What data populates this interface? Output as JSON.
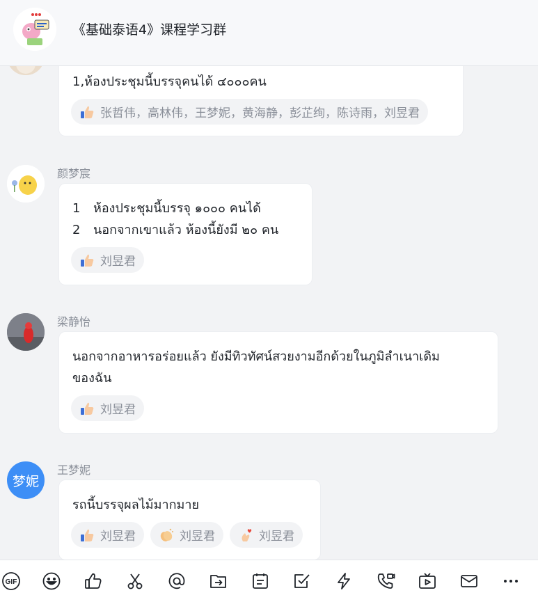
{
  "header": {
    "title": "《基础泰语4》课程学习群",
    "avatar_icon": "group-avatar-cartoon"
  },
  "messages": [
    {
      "sender": "",
      "lines": [
        "1,ห้องประชุมนี้บรรจุคนได้ ๔๐๐๐คน"
      ],
      "reactions": [
        {
          "emoji": "thumbs-up",
          "users": "张哲伟，高林伟，王梦妮，黄海静，彭芷绚，陈诗雨，刘昱君"
        }
      ]
    },
    {
      "sender": "颜梦宸",
      "lines": [
        {
          "num": "1",
          "text": "ห้องประชุมนี้บรรจุ ๑๐๐๐ คนได้"
        },
        {
          "num": "2",
          "text": "นอกจากเขาแล้ว ห้องนี้ยังมี ๒๐ คน"
        }
      ],
      "reactions": [
        {
          "emoji": "thumbs-up",
          "users": "刘昱君"
        }
      ]
    },
    {
      "sender": "梁静怡",
      "lines": [
        "นอกจากอาหารอร่อยแล้ว ยังมีทิวทัศน์สวยงามอีกด้วยในภูมิลำเนาเดิม",
        "ของฉัน"
      ],
      "reactions": [
        {
          "emoji": "thumbs-up",
          "users": "刘昱君"
        }
      ]
    },
    {
      "sender": "王梦妮",
      "avatar_text": "梦妮",
      "lines": [
        "รถนี้บรรจุผลไม้มากมาย"
      ],
      "reactions": [
        {
          "emoji": "thumbs-up",
          "users": "刘昱君"
        },
        {
          "emoji": "clapping-hands",
          "users": "刘昱君"
        },
        {
          "emoji": "finger-heart",
          "users": "刘昱君"
        }
      ]
    }
  ],
  "toolbar": {
    "gif_label": "GIF",
    "icons": [
      "gif-icon",
      "emoji-icon",
      "thumbs-up-icon",
      "scissors-icon",
      "at-mention-icon",
      "forward-icon",
      "calendar-note-icon",
      "task-check-icon",
      "lightning-icon",
      "phone-call-icon",
      "video-play-icon",
      "mail-icon",
      "more-icon"
    ]
  },
  "colors": {
    "background": "#f2f3f5",
    "bubble": "#ffffff",
    "accent_avatar": "#3d8ef6",
    "muted_text": "#8a8f99"
  }
}
